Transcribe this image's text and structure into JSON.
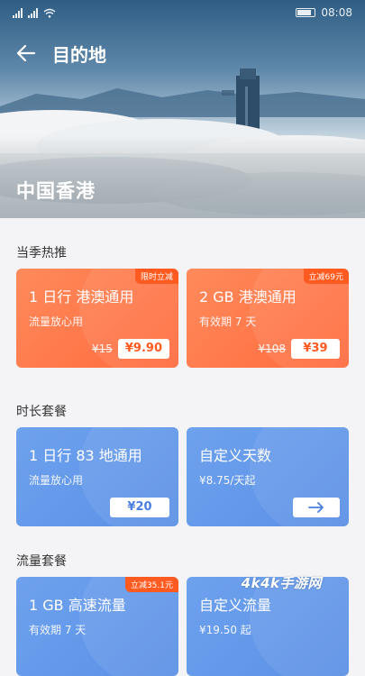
{
  "status_bar": {
    "time": "08:08"
  },
  "header": {
    "title": "目的地",
    "region": "中国香港"
  },
  "sections": [
    {
      "title": "当季热推",
      "cards": [
        {
          "title": "1 日行  港澳通用",
          "subtitle": "流量放心用",
          "ribbon": "限时立减",
          "old_price": "¥15",
          "price": "¥9.90"
        },
        {
          "title": "2 GB 港澳通用",
          "subtitle": "有效期 7 天",
          "ribbon": "立减69元",
          "old_price": "¥108",
          "price": "¥39"
        }
      ]
    },
    {
      "title": "时长套餐",
      "cards": [
        {
          "title": "1 日行  83 地通用",
          "subtitle": "流量放心用",
          "price": "¥20"
        },
        {
          "title": "自定义天数",
          "subtitle": "¥8.75/天起",
          "action_icon": "arrow-right-icon"
        }
      ]
    },
    {
      "title": "流量套餐",
      "cards": [
        {
          "title": "1 GB 高速流量",
          "subtitle": "有效期 7 天",
          "ribbon": "立减35.1元"
        },
        {
          "title": "自定义流量",
          "subtitle": "¥19.50 起"
        }
      ]
    }
  ],
  "watermark": "4k4k手游网",
  "colors": {
    "orange": "#ff6a3d",
    "blue": "#5a8fe6",
    "ribbon": "#ff5a1f"
  }
}
